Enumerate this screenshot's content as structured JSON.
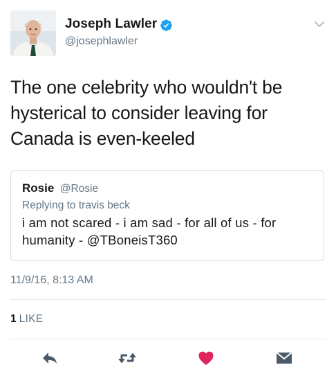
{
  "author": {
    "name": "Joseph Lawler",
    "handle": "@josephlawler",
    "verified": true
  },
  "tweet": {
    "text": "The one celebrity who wouldn't be hysterical to consider leaving for Canada is even-keeled",
    "timestamp": "11/9/16, 8:13 AM",
    "likes_count": "1",
    "likes_label": "LIKE"
  },
  "quoted_tweet": {
    "name": "Rosie",
    "handle": "@Rosie",
    "replying_to": "Replying to travis beck",
    "text": "i am not scared - i am sad - for all of us - for humanity - @TBoneisT360"
  },
  "actions": [
    {
      "name": "reply",
      "icon": "reply-icon"
    },
    {
      "name": "retweet",
      "icon": "retweet-icon"
    },
    {
      "name": "like",
      "icon": "heart-icon"
    },
    {
      "name": "message",
      "icon": "envelope-icon"
    }
  ],
  "colors": {
    "verified_blue": "#1da1f2",
    "like_red": "#e0245e",
    "secondary_text": "#657786",
    "icon_gray": "#4a5a68"
  }
}
